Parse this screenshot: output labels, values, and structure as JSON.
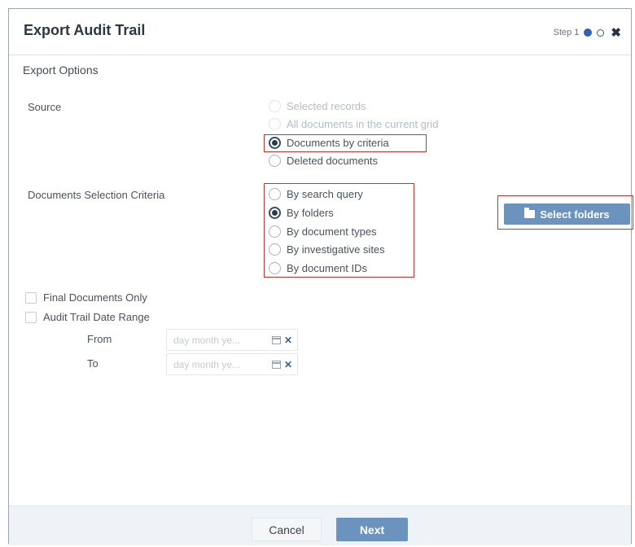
{
  "dialog": {
    "title": "Export Audit Trail",
    "step_label": "Step 1",
    "close_glyph": "✖"
  },
  "export_options": {
    "title": "Export Options",
    "source_label": "Source",
    "source_options": [
      {
        "label": "Selected records",
        "selected": false,
        "enabled": false
      },
      {
        "label": "All documents in the current grid",
        "selected": false,
        "enabled": false
      },
      {
        "label": "Documents by criteria",
        "selected": true,
        "enabled": true
      },
      {
        "label": "Deleted documents",
        "selected": false,
        "enabled": true
      }
    ],
    "criteria_label": "Documents Selection Criteria",
    "criteria_options": [
      {
        "label": "By search query",
        "selected": false
      },
      {
        "label": "By folders",
        "selected": true
      },
      {
        "label": "By document types",
        "selected": false
      },
      {
        "label": "By investigative sites",
        "selected": false
      },
      {
        "label": "By document IDs",
        "selected": false
      }
    ],
    "select_folders_label": "Select folders",
    "final_documents_only_label": "Final Documents Only",
    "date_range_label": "Audit Trail Date Range",
    "from_label": "From",
    "to_label": "To",
    "from_placeholder": "day month ye...",
    "to_placeholder": "day month ye..."
  },
  "footer": {
    "cancel_label": "Cancel",
    "next_label": "Next"
  },
  "colors": {
    "accent": "#6b93bd",
    "highlight": "#b8383a"
  },
  "icons": [
    "folder-icon",
    "calendar-icon",
    "clear-icon",
    "close-icon"
  ]
}
